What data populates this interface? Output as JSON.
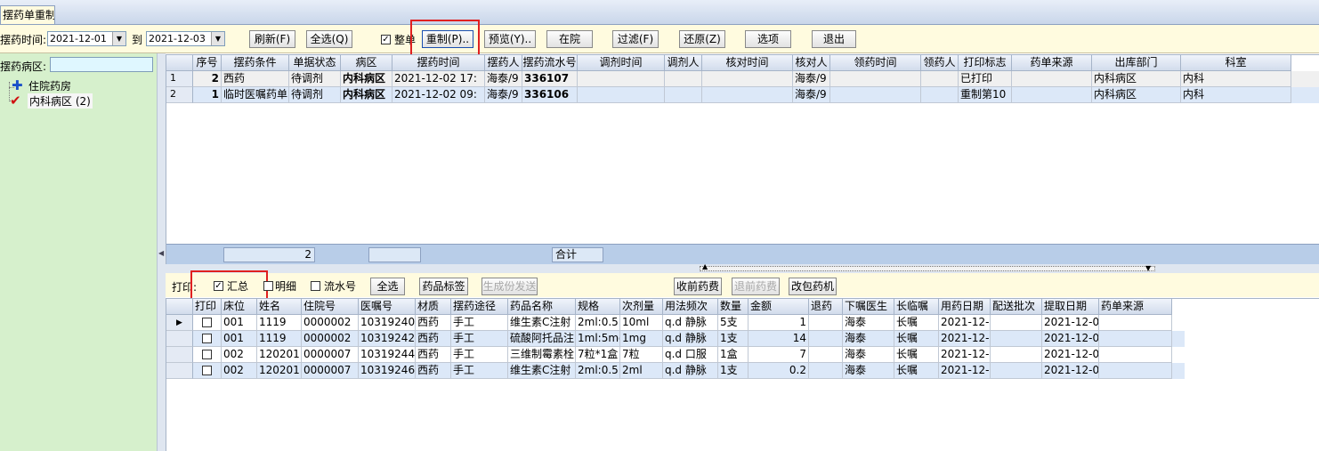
{
  "window": {
    "tab_title": "摆药单重制"
  },
  "toolbar": {
    "time_label": "摆药时间:",
    "date_from": "2021-12-01",
    "to_label": "到",
    "date_to": "2021-12-03",
    "refresh": "刷新(F)",
    "select_all": "全选(Q)",
    "whole_label": "整单",
    "whole_checked": true,
    "redo": "重制(P)..",
    "preview": "预览(Y)..",
    "inpatient": "在院",
    "filter": "过滤(F)",
    "restore": "还原(Z)",
    "options": "选项",
    "exit": "退出"
  },
  "left": {
    "ward_label": "摆药病区:",
    "tree": [
      {
        "icon": "plus-icon",
        "label": "住院药房"
      },
      {
        "icon": "check-icon",
        "label": "内科病区 (2)"
      }
    ]
  },
  "upper_grid": {
    "columns": [
      "序号",
      "摆药条件",
      "单据状态",
      "病区",
      "摆药时间",
      "摆药人",
      "摆药流水号",
      "调剂时间",
      "调剂人",
      "核对时间",
      "核对人",
      "领药时间",
      "领药人",
      "打印标志",
      "药单来源",
      "出库部门",
      "科室"
    ],
    "rows": [
      {
        "rownum": "1",
        "seq": "2",
        "cond": "西药",
        "status": "待调剂",
        "ward": "内科病区",
        "time": "2021-12-02 17:",
        "person": "海泰/9",
        "serial": "336107",
        "adj_time": "",
        "adj_person": "",
        "chk_time": "",
        "chk_person": "海泰/9",
        "take_time": "",
        "taker": "",
        "print": "已打印",
        "source": "",
        "dept": "内科病区",
        "office": "内科"
      },
      {
        "rownum": "2",
        "seq": "1",
        "cond": "临时医嘱药单",
        "status": "待调剂",
        "ward": "内科病区",
        "time": "2021-12-02 09:",
        "person": "海泰/9",
        "serial": "336106",
        "adj_time": "",
        "adj_person": "",
        "chk_time": "",
        "chk_person": "海泰/9",
        "take_time": "",
        "taker": "",
        "print": "重制第10",
        "source": "",
        "dept": "内科病区",
        "office": "内科"
      }
    ],
    "footer": {
      "count": "2",
      "total_label": "合计"
    }
  },
  "print_bar": {
    "print_label": "打印:",
    "summary": "汇总",
    "summary_checked": true,
    "detail": "明细",
    "detail_checked": false,
    "serial": "流水号",
    "serial_checked": false,
    "select_all": "全选",
    "drug_label": "药品标签",
    "generate": "生成份发送",
    "collect_fee": "收前药费",
    "refund_fee": "退前药费",
    "repack": "改包药机"
  },
  "lower_grid": {
    "columns": [
      "打印",
      "床位",
      "姓名",
      "住院号",
      "医嘱号",
      "材质",
      "摆药途径",
      "药品名称",
      "规格",
      "次剂量",
      "用法频次",
      "数量",
      "金额",
      "退药",
      "下嘱医生",
      "长临嘱",
      "用药日期",
      "配送批次",
      "提取日期",
      "药单来源"
    ],
    "rows": [
      {
        "bed": "001",
        "name": "1119",
        "admission": "0000002",
        "order": "10319240",
        "material": "西药",
        "route": "手工",
        "drug": "维生素C注射",
        "spec": "2ml:0.5",
        "dose": "10ml",
        "usage": "q.d 静脉",
        "qty": "5支",
        "amount": "1",
        "ret": "",
        "doctor": "海泰",
        "type": "长嘱",
        "use_date": "2021-12-",
        "batch": "",
        "extract": "2021-12-0",
        "source": ""
      },
      {
        "bed": "001",
        "name": "1119",
        "admission": "0000002",
        "order": "10319242",
        "material": "西药",
        "route": "手工",
        "drug": "硫酸阿托品注",
        "spec": "1ml:5mg",
        "dose": "1mg",
        "usage": "q.d 静脉",
        "qty": "1支",
        "amount": "14",
        "ret": "",
        "doctor": "海泰",
        "type": "长嘱",
        "use_date": "2021-12-",
        "batch": "",
        "extract": "2021-12-0",
        "source": ""
      },
      {
        "bed": "002",
        "name": "120201",
        "admission": "0000007",
        "order": "10319244",
        "material": "西药",
        "route": "手工",
        "drug": "三维制霉素栓",
        "spec": "7粒*1盒",
        "dose": "7粒",
        "usage": "q.d 口服",
        "qty": "1盒",
        "amount": "7",
        "ret": "",
        "doctor": "海泰",
        "type": "长嘱",
        "use_date": "2021-12-",
        "batch": "",
        "extract": "2021-12-0",
        "source": ""
      },
      {
        "bed": "002",
        "name": "120201",
        "admission": "0000007",
        "order": "10319246",
        "material": "西药",
        "route": "手工",
        "drug": "维生素C注射",
        "spec": "2ml:0.5",
        "dose": "2ml",
        "usage": "q.d 静脉",
        "qty": "1支",
        "amount": "0.2",
        "ret": "",
        "doctor": "海泰",
        "type": "长嘱",
        "use_date": "2021-12-",
        "batch": "",
        "extract": "2021-12-0",
        "source": ""
      }
    ]
  }
}
